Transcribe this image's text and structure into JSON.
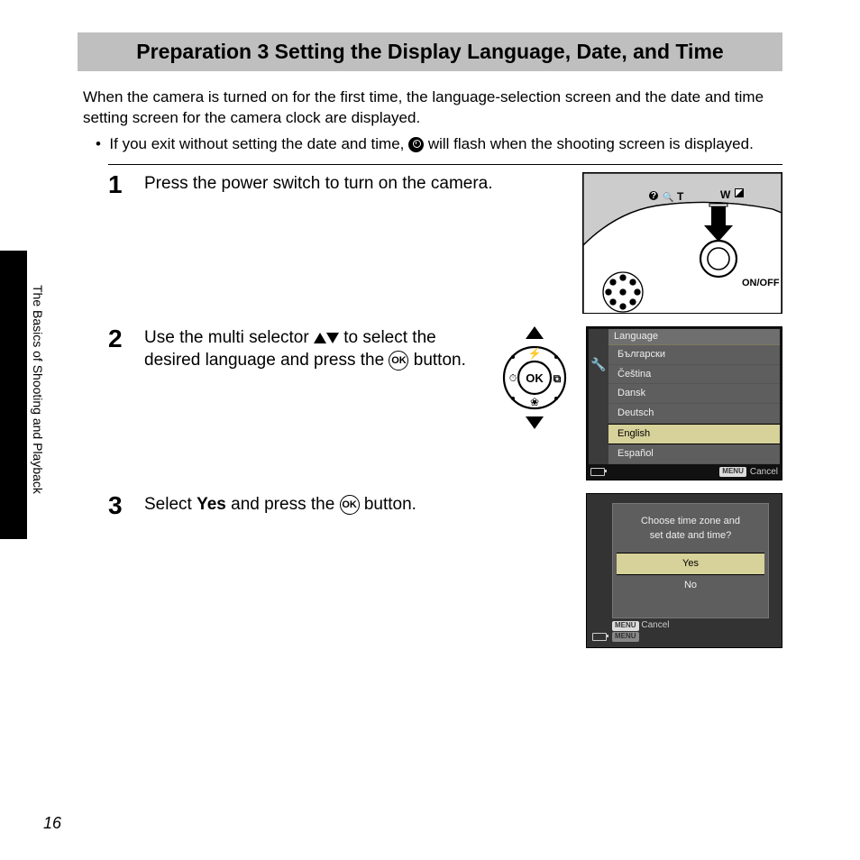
{
  "title": "Preparation 3 Setting the Display Language, Date, and Time",
  "intro": "When the camera is turned on for the first time, the language-selection screen and the date and time setting screen for the camera clock are displayed.",
  "bullet_pre": "If you exit without setting the date and time, ",
  "bullet_post": " will flash when the shooting screen is displayed.",
  "step1": {
    "num": "1",
    "text": "Press the power switch to turn on the camera.",
    "onoff": "ON/OFF"
  },
  "step2": {
    "num": "2",
    "text_pre": "Use the multi selector ",
    "text_mid": " to select the desired language and press the ",
    "text_post": " button.",
    "ok": "OK",
    "lcd_title": "Language",
    "langs": [
      "Български",
      "Čeština",
      "Dansk",
      "Deutsch",
      "English",
      "Español"
    ],
    "cancel": "Cancel",
    "menu": "MENU"
  },
  "step3": {
    "num": "3",
    "text_pre": "Select ",
    "bold": "Yes",
    "text_mid": " and press the ",
    "text_post": " button.",
    "msg1": "Choose time zone and",
    "msg2": "set date and time?",
    "yes": "Yes",
    "no": "No",
    "cancel": "Cancel",
    "menu": "MENU"
  },
  "side_label": "The Basics of Shooting and Playback",
  "page_number": "16",
  "ok_glyph": "OK"
}
